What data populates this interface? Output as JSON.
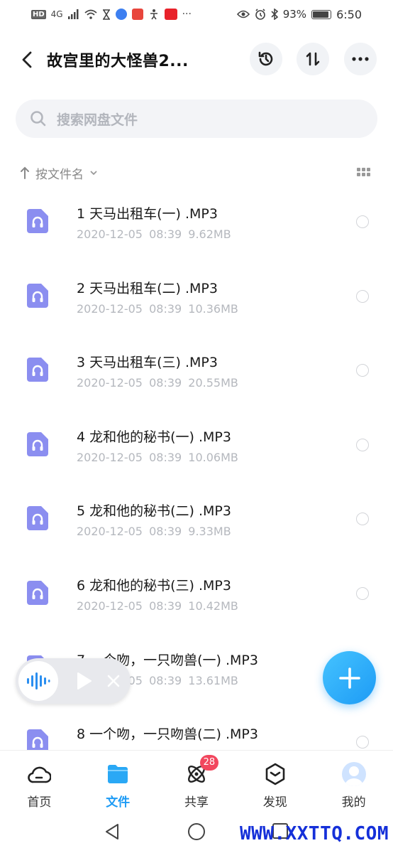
{
  "status_bar": {
    "hd": "HD",
    "network": "4G",
    "battery_percent": "93%",
    "time": "6:50"
  },
  "header": {
    "title": "故宫里的大怪兽2...",
    "back_icon": "chevron-left-icon",
    "history_icon": "history-icon",
    "sort_icon": "sort-icon",
    "more_icon": "more-icon"
  },
  "search": {
    "placeholder": "搜索网盘文件"
  },
  "sortbar": {
    "label": "按文件名"
  },
  "files": [
    {
      "name": "1 天马出租车(一) .MP3",
      "date": "2020-12-05",
      "time": "08:39",
      "size": "9.62MB"
    },
    {
      "name": "2 天马出租车(二) .MP3",
      "date": "2020-12-05",
      "time": "08:39",
      "size": "10.36MB"
    },
    {
      "name": "3 天马出租车(三) .MP3",
      "date": "2020-12-05",
      "time": "08:39",
      "size": "20.55MB"
    },
    {
      "name": "4 龙和他的秘书(一) .MP3",
      "date": "2020-12-05",
      "time": "08:39",
      "size": "10.06MB"
    },
    {
      "name": "5 龙和他的秘书(二) .MP3",
      "date": "2020-12-05",
      "time": "08:39",
      "size": "9.33MB"
    },
    {
      "name": "6 龙和他的秘书(三) .MP3",
      "date": "2020-12-05",
      "time": "08:39",
      "size": "10.42MB"
    },
    {
      "name": "7 一个吻，一只吻兽(一) .MP3",
      "date": "2020-12-05",
      "time": "08:39",
      "size": "13.61MB"
    },
    {
      "name": "8 一个吻，一只吻兽(二) .MP3",
      "date": "",
      "time": "",
      "size": ""
    }
  ],
  "bottom_nav": [
    {
      "label": "首页",
      "icon": "cloud-home-icon",
      "active": false
    },
    {
      "label": "文件",
      "icon": "folder-icon",
      "active": true
    },
    {
      "label": "共享",
      "icon": "share-atom-icon",
      "active": false,
      "badge": "28"
    },
    {
      "label": "发现",
      "icon": "discover-cube-icon",
      "active": false
    },
    {
      "label": "我的",
      "icon": "avatar-icon",
      "active": false
    }
  ],
  "colors": {
    "accent": "#1d9bf5",
    "file_icon": "#8b8ef0",
    "badge": "#f2475e"
  },
  "watermark": "WWW.XXTTQ.COM"
}
